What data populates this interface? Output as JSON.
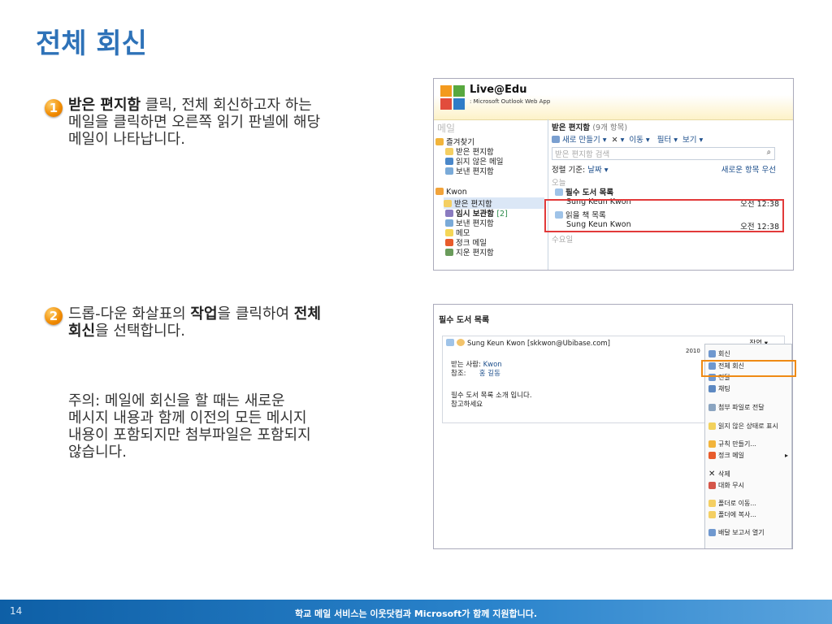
{
  "title": "전체 회신",
  "step1": {
    "num": "1",
    "bold": "받은 편지함",
    "text_a": " 클릭, 전체  회신하고자 하는",
    "line2": "메일을 클릭하면 오른쪽 읽기 판넬에 해당",
    "line3": "메일이 나타납니다."
  },
  "step2": {
    "num": "2",
    "text_a": "드롭-다운 화살표의 ",
    "bold_a": "작업",
    "text_b": "을 클릭하여  ",
    "bold_b": "전체",
    "bold_c": "회신",
    "text_c": "을 선택합니다."
  },
  "note": {
    "l1": "주의: 메일에 회신을 할 때는 새로운",
    "l2": "메시지 내용과 함께 이전의 모든 메시지",
    "l3": "내용이 포함되지만 첨부파일은 포함되지",
    "l4": "않습니다."
  },
  "owa": {
    "brand": "Live@Edu",
    "sub": ": Microsoft Outlook Web App",
    "mail_label": "메일",
    "tree": [
      "즐겨찾기",
      "받은 편지함",
      "읽지 않은 메일",
      "보낸 편지함",
      "Kwon",
      "받은 편지함",
      "임시 보관함",
      "보낸 편지함",
      "메모",
      "정크 메일",
      "지운 편지함"
    ],
    "drafts_count": "[2]",
    "inbox_title": "받은 편지함",
    "inbox_count": "(9개 항목)",
    "toolbar": {
      "new": "새로 만들기",
      "delete": "✕",
      "move": "이동",
      "filter": "필터",
      "view": "보기"
    },
    "search_placeholder": "받은 편지함 검색",
    "sort_label": "정렬 기준:",
    "sort_value": "날짜",
    "sort_order": "새로운 항목 우선",
    "group_today": "오늘",
    "group_wed": "수요일",
    "messages": [
      {
        "subject": "필수 도서 목록",
        "from": "Sung Keun Kwon",
        "time": "오전 12:38"
      },
      {
        "subject": "읽을 책 목록",
        "from": "Sung Keun Kwon",
        "time": "오전 12:38"
      }
    ]
  },
  "reading": {
    "subject": "필수 도서 목록",
    "sender": "Sung Keun Kwon [skkwon@Ubibase.com]",
    "action": "작업",
    "date": "2010",
    "to_label": "받는 사람:",
    "to": "Kwon",
    "cc_label": "참조:",
    "cc": "홍 길동",
    "body1": "필수 도서 목록 소개 입니다.",
    "body2": "참고하세요",
    "menu": [
      "회신",
      "전체 회신",
      "전달",
      "채팅",
      "첨부 파일로 전달",
      "읽지 않은 상태로 표시",
      "규칙 만들기...",
      "정크 메일",
      "삭제",
      "대화 무시",
      "폴더로 이동...",
      "폴더에 복사...",
      "배달 보고서 열기"
    ]
  },
  "footer": {
    "page": "14",
    "text": "학교 메일 서비스는 이웃닷컴과 Microsoft가 함께 지원합니다."
  }
}
